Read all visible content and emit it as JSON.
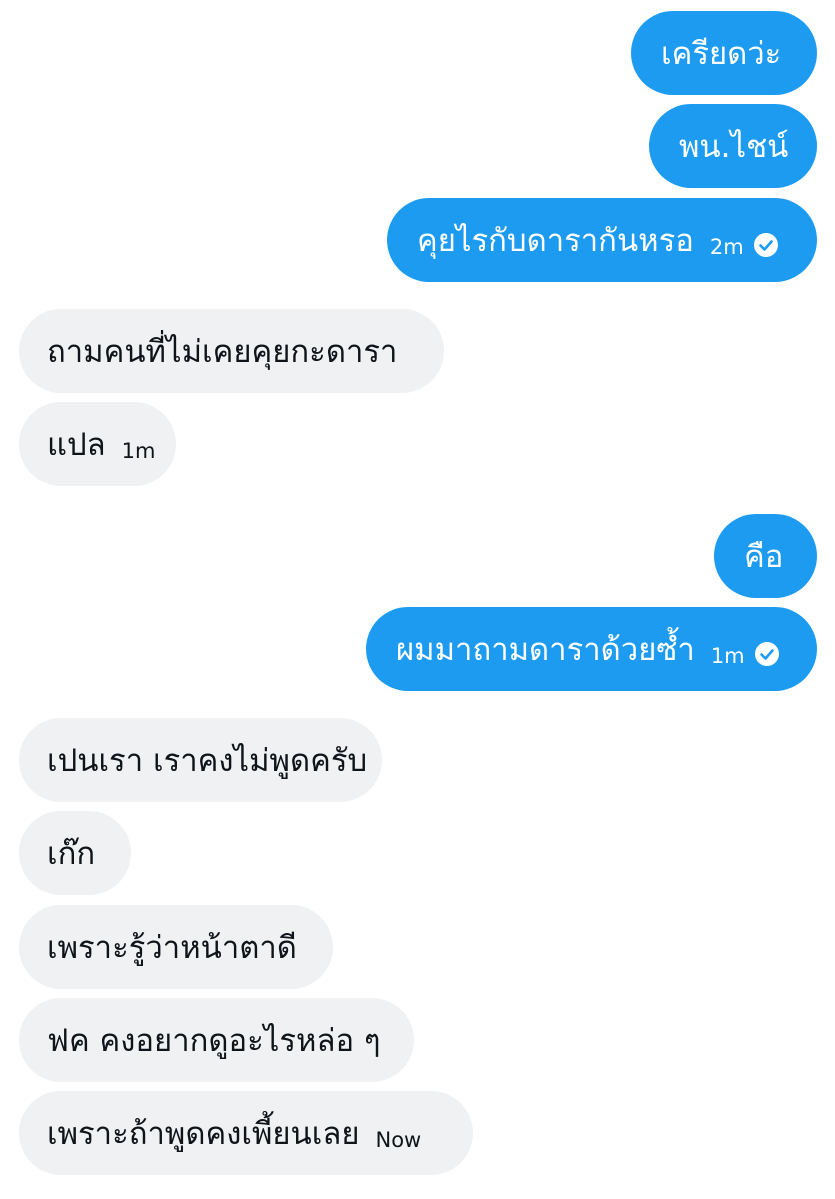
{
  "colors": {
    "outgoing_bubble": "#1d9bf0",
    "incoming_bubble": "#eff1f3",
    "outgoing_text": "#ffffff",
    "incoming_text": "#0f1419"
  },
  "messages": [
    {
      "direction": "outgoing",
      "text": "เครียดว่ะ"
    },
    {
      "direction": "outgoing",
      "text": "พน.ไชน์"
    },
    {
      "direction": "outgoing",
      "text": "คุยไรกับดารากันหรอ",
      "time": "2m",
      "status_icon": "read-check-icon"
    },
    {
      "direction": "incoming",
      "text": "ถามคนที่ไม่เคยคุยกะดารา"
    },
    {
      "direction": "incoming",
      "text": "แปล",
      "time": "1m"
    },
    {
      "direction": "outgoing",
      "text": "คือ"
    },
    {
      "direction": "outgoing",
      "text": "ผมมาถามดาราด้วยซ้ำ",
      "time": "1m",
      "status_icon": "read-check-icon"
    },
    {
      "direction": "incoming",
      "text": "เปนเรา เราคงไม่พูดครับ"
    },
    {
      "direction": "incoming",
      "text": "เก๊ก"
    },
    {
      "direction": "incoming",
      "text": "เพราะรู้ว่าหน้าตาดี"
    },
    {
      "direction": "incoming",
      "text": "ฟค คงอยากดูอะไรหล่อ ๆ"
    },
    {
      "direction": "incoming",
      "text": "เพราะถ้าพูดคงเพี้ยนเลย",
      "time": "Now"
    }
  ]
}
